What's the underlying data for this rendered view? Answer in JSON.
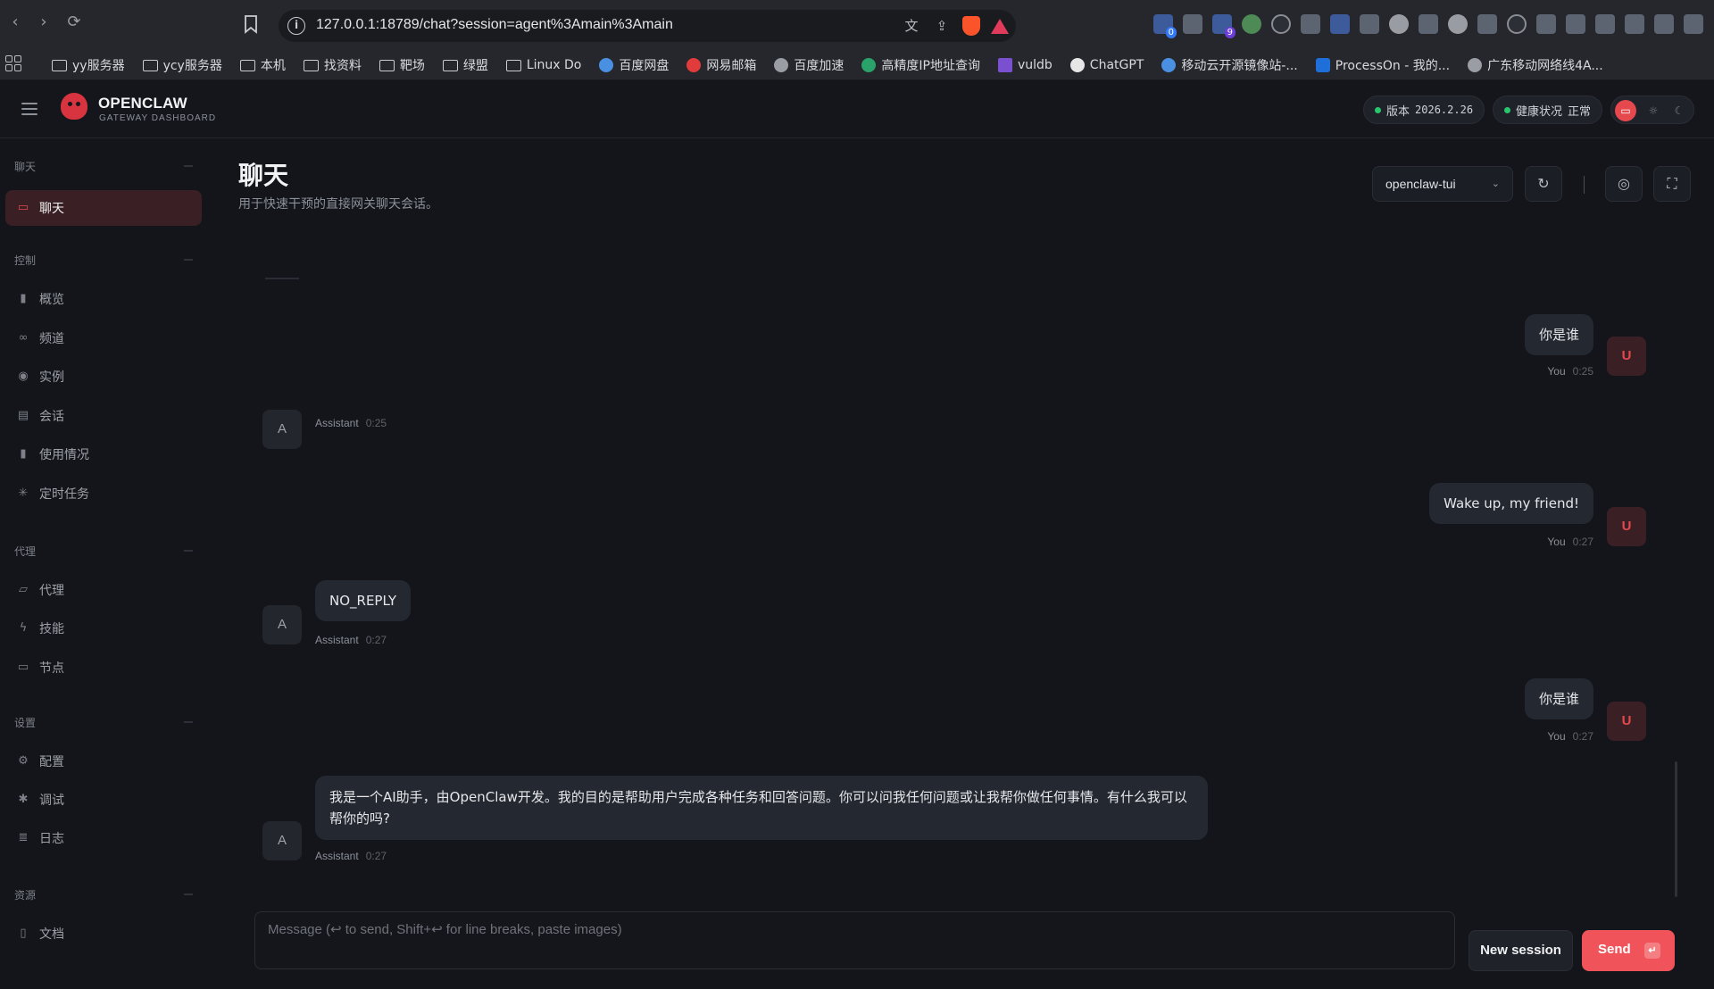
{
  "browser": {
    "url": "127.0.0.1:18789/chat?session=agent%3Amain%3Amain",
    "bookmarks": [
      {
        "label": "yy服务器",
        "icon": "folder-icon"
      },
      {
        "label": "ycy服务器",
        "icon": "folder-icon"
      },
      {
        "label": "本机",
        "icon": "folder-icon"
      },
      {
        "label": "找资料",
        "icon": "folder-icon"
      },
      {
        "label": "靶场",
        "icon": "folder-icon"
      },
      {
        "label": "绿盟",
        "icon": "folder-icon"
      },
      {
        "label": "Linux Do",
        "icon": "folder-icon"
      },
      {
        "label": "百度网盘",
        "icon": "cloud-icon"
      },
      {
        "label": "网易邮箱",
        "icon": "mail-icon"
      },
      {
        "label": "百度加速",
        "icon": "globe-icon"
      },
      {
        "label": "高精度IP地址查询",
        "icon": "ip-icon"
      },
      {
        "label": "vuldb",
        "icon": "vuldb-icon"
      },
      {
        "label": "ChatGPT",
        "icon": "chatgpt-icon"
      },
      {
        "label": "移动云开源镜像站-...",
        "icon": "cloud-icon"
      },
      {
        "label": "ProcessOn - 我的...",
        "icon": "processon-icon"
      },
      {
        "label": "广东移动网络线4A...",
        "icon": "globe-icon"
      }
    ],
    "extension_badges": {
      "first": "0",
      "second": "9"
    }
  },
  "header": {
    "brand_title": "OPENCLAW",
    "brand_subtitle": "GATEWAY DASHBOARD",
    "version_label": "版本",
    "version_value": "2026.2.26",
    "health_label": "健康状况",
    "health_value": "正常",
    "status_color": "#28c76f",
    "accent": "#e5484d"
  },
  "sidebar": {
    "sections": [
      {
        "title": "聊天",
        "items": [
          {
            "label": "聊天",
            "icon": "chat-icon",
            "active": true
          }
        ]
      },
      {
        "title": "控制",
        "items": [
          {
            "label": "概览",
            "icon": "bar-chart-icon"
          },
          {
            "label": "频道",
            "icon": "link-icon"
          },
          {
            "label": "实例",
            "icon": "radio-icon"
          },
          {
            "label": "会话",
            "icon": "document-icon"
          },
          {
            "label": "使用情况",
            "icon": "bar-chart-icon"
          },
          {
            "label": "定时任务",
            "icon": "spinner-icon"
          }
        ]
      },
      {
        "title": "代理",
        "items": [
          {
            "label": "代理",
            "icon": "folder-icon"
          },
          {
            "label": "技能",
            "icon": "lightning-icon"
          },
          {
            "label": "节点",
            "icon": "monitor-icon"
          }
        ]
      },
      {
        "title": "设置",
        "items": [
          {
            "label": "配置",
            "icon": "gear-icon"
          },
          {
            "label": "调试",
            "icon": "bug-icon"
          },
          {
            "label": "日志",
            "icon": "log-icon"
          }
        ]
      },
      {
        "title": "资源",
        "items": [
          {
            "label": "文档",
            "icon": "book-icon"
          }
        ]
      }
    ]
  },
  "main": {
    "title": "聊天",
    "subtitle": "用于快速干预的直接网关聊天会话。",
    "session_select": "openclaw-tui",
    "messages": [
      {
        "role": "user",
        "text": "你是谁",
        "sender": "You",
        "time": "0:25",
        "avatar": "U"
      },
      {
        "role": "assistant",
        "text": "",
        "sender": "Assistant",
        "time": "0:25",
        "avatar": "A"
      },
      {
        "role": "user",
        "text": "Wake up, my friend!",
        "sender": "You",
        "time": "0:27",
        "avatar": "U"
      },
      {
        "role": "assistant",
        "text": "NO_REPLY",
        "sender": "Assistant",
        "time": "0:27",
        "avatar": "A"
      },
      {
        "role": "user",
        "text": "你是谁",
        "sender": "You",
        "time": "0:27",
        "avatar": "U"
      },
      {
        "role": "assistant",
        "text": "我是一个AI助手，由OpenClaw开发。我的目的是帮助用户完成各种任务和回答问题。你可以问我任何问题或让我帮你做任何事情。有什么我可以帮你的吗?",
        "sender": "Assistant",
        "time": "0:27",
        "avatar": "A"
      }
    ]
  },
  "composer": {
    "placeholder": "Message (↩ to send, Shift+↩ for line breaks, paste images)",
    "new_session_label": "New session",
    "send_label": "Send",
    "send_shortcut": "↵"
  }
}
